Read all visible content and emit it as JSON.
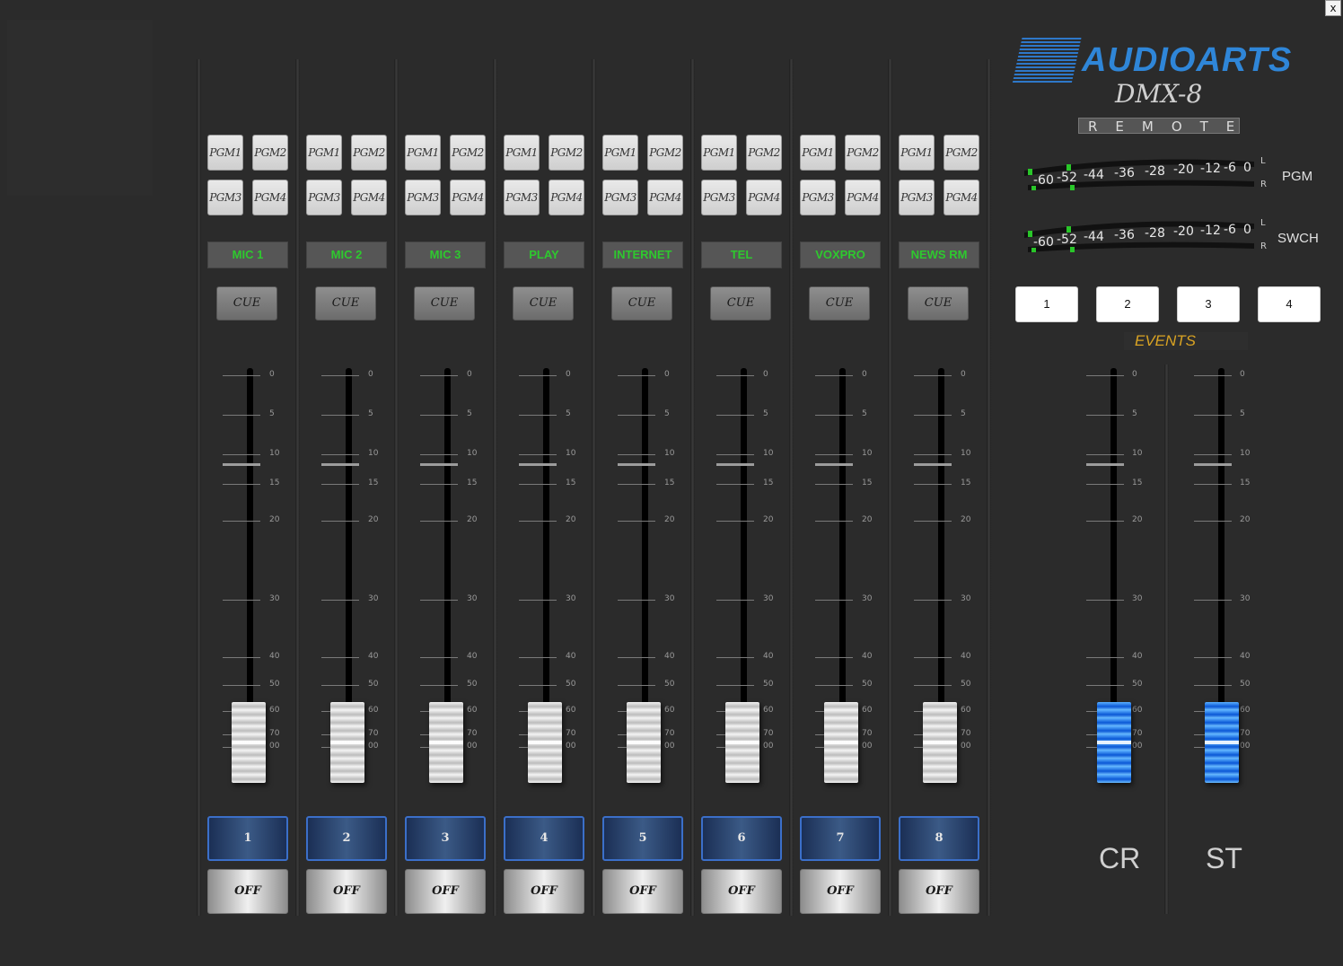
{
  "window": {
    "close_label": "x"
  },
  "channels": [
    {
      "name": "MIC 1",
      "number": "1"
    },
    {
      "name": "MIC 2",
      "number": "2"
    },
    {
      "name": "MIC 3",
      "number": "3"
    },
    {
      "name": "PLAY",
      "number": "4"
    },
    {
      "name": "INTERNET",
      "number": "5"
    },
    {
      "name": "TEL",
      "number": "6"
    },
    {
      "name": "VOXPRO",
      "number": "7"
    },
    {
      "name": "NEWS RM",
      "number": "8"
    }
  ],
  "pgm_buttons": [
    "PGM1",
    "PGM2",
    "PGM3",
    "PGM4"
  ],
  "cue_label": "CUE",
  "off_label": "OFF",
  "fader_scale": [
    "0",
    "5",
    "10",
    "15",
    "20",
    "30",
    "40",
    "50",
    "60",
    "70",
    "00"
  ],
  "fader_level": "00",
  "logo": {
    "brand": "AUDIOARTS",
    "model": "DMX-8",
    "remote": "REMOTE"
  },
  "meters": [
    {
      "name": "PGM",
      "scale": [
        "-60",
        "-52",
        "-44",
        "-36",
        "-28",
        "-20",
        "-12",
        "-6",
        "0"
      ],
      "left": "L",
      "right": "R"
    },
    {
      "name": "SWCH",
      "scale": [
        "-60",
        "-52",
        "-44",
        "-36",
        "-28",
        "-20",
        "-12",
        "-6",
        "0"
      ],
      "left": "L",
      "right": "R"
    }
  ],
  "events": {
    "label": "EVENTS",
    "buttons": [
      "1",
      "2",
      "3",
      "4"
    ]
  },
  "masters": [
    {
      "name": "CR"
    },
    {
      "name": "ST"
    }
  ],
  "colors": {
    "label_green": "#2ec92e",
    "events_gold": "#d9a323",
    "brand_blue": "#2f86d8",
    "master_knob_blue": "#0a57d6"
  }
}
